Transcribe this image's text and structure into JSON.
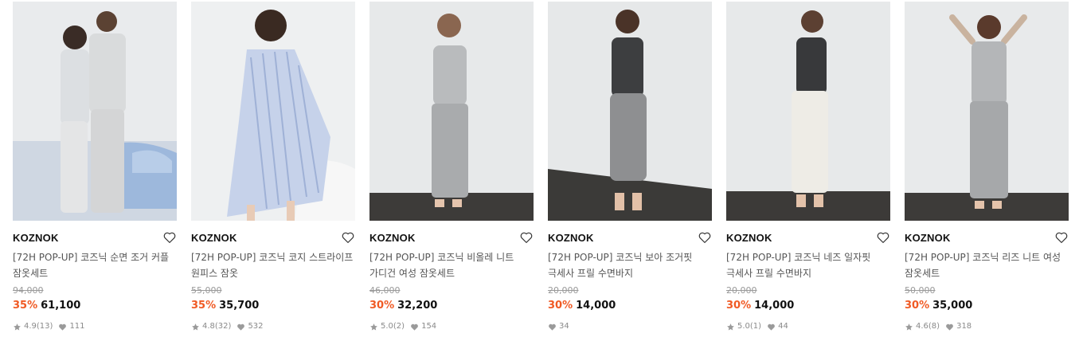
{
  "products": [
    {
      "brand": "KOZNOK",
      "title": "[72H POP-UP] 코즈닉 순면 조거 커플 잠옷세트",
      "original_price": "94,000",
      "discount": "35%",
      "price": "61,100",
      "rating": "4.9",
      "review_count": "(13)",
      "likes": "111",
      "image": "couple-pajama-photo"
    },
    {
      "brand": "KOZNOK",
      "title": "[72H POP-UP] 코즈닉 코지 스트라이프 원피스 잠옷",
      "original_price": "55,000",
      "discount": "35%",
      "price": "35,700",
      "rating": "4.8",
      "review_count": "(32)",
      "likes": "532",
      "image": "stripe-dress-photo"
    },
    {
      "brand": "KOZNOK",
      "title": "[72H POP-UP] 코즈닉 비올레 니트 가디건 여성 잠옷세트",
      "original_price": "46,000",
      "discount": "30%",
      "price": "32,200",
      "rating": "5.0",
      "review_count": "(2)",
      "likes": "154",
      "image": "knit-cardigan-set-photo"
    },
    {
      "brand": "KOZNOK",
      "title": "[72H POP-UP] 코즈닉 보아 조거핏 극세사 프릴 수면바지",
      "original_price": "20,000",
      "discount": "30%",
      "price": "14,000",
      "rating": "",
      "review_count": "",
      "likes": "34",
      "image": "fleece-jogger-photo"
    },
    {
      "brand": "KOZNOK",
      "title": "[72H POP-UP] 코즈닉 네즈 일자핏 극세사 프릴 수면바지",
      "original_price": "20,000",
      "discount": "30%",
      "price": "14,000",
      "rating": "5.0",
      "review_count": "(1)",
      "likes": "44",
      "image": "fleece-straight-pants-photo"
    },
    {
      "brand": "KOZNOK",
      "title": "[72H POP-UP] 코즈닉 리즈 니트 여성 잠옷세트",
      "original_price": "50,000",
      "discount": "30%",
      "price": "35,000",
      "rating": "4.6",
      "review_count": "(8)",
      "likes": "318",
      "image": "knit-set-photo"
    }
  ],
  "colors": {
    "discount": "#f05a24",
    "text": "#111111",
    "muted": "#9a9a9a"
  }
}
